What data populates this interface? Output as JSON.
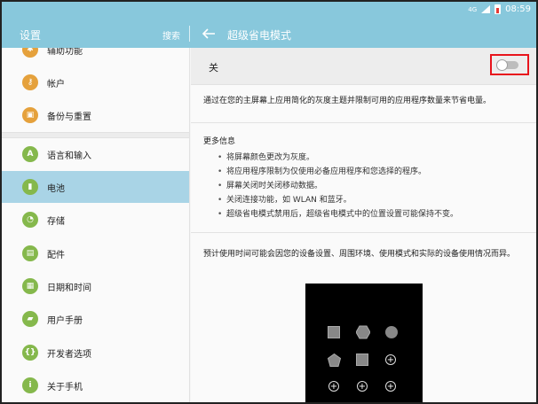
{
  "status_bar": {
    "network": "4G",
    "time": "08:59",
    "battery_color": "#e53935"
  },
  "app_bar": {
    "left_title": "设置",
    "search_label": "搜索",
    "right_title": "超级省电模式",
    "background_color": "#88c8dc"
  },
  "sidebar": {
    "items": [
      {
        "label": "辅助功能",
        "icon": "accessibility-icon"
      },
      {
        "label": "帐户",
        "icon": "key-icon"
      },
      {
        "label": "备份与重置",
        "icon": "backup-icon"
      },
      {
        "label": "语言和输入",
        "icon": "language-icon"
      },
      {
        "label": "电池",
        "icon": "battery-icon",
        "active": true
      },
      {
        "label": "存储",
        "icon": "storage-icon"
      },
      {
        "label": "配件",
        "icon": "accessory-icon"
      },
      {
        "label": "日期和时间",
        "icon": "calendar-icon"
      },
      {
        "label": "用户手册",
        "icon": "manual-icon"
      },
      {
        "label": "开发者选项",
        "icon": "developer-icon"
      },
      {
        "label": "关于手机",
        "icon": "info-icon"
      }
    ],
    "active_color": "#a9d4e6"
  },
  "main": {
    "toggle_label": "关",
    "toggle_on": false,
    "description": "通过在您的主屏幕上应用简化的灰度主题并限制可用的应用程序数量来节省电量。",
    "more_info_title": "更多信息",
    "bullets": [
      "将屏幕颜色更改为灰度。",
      "将应用程序限制为仅使用必备应用程序和您选择的程序。",
      "屏幕关闭时关闭移动数据。",
      "关闭连接功能，如 WLAN 和蓝牙。",
      "超级省电模式禁用后，超级省电模式中的位置设置可能保持不变。"
    ],
    "estimate_text": "预计使用时间可能会因您的设备设置、周围环境、使用模式和实际的设备使用情况而异。",
    "highlight_color": "#e8141c"
  }
}
